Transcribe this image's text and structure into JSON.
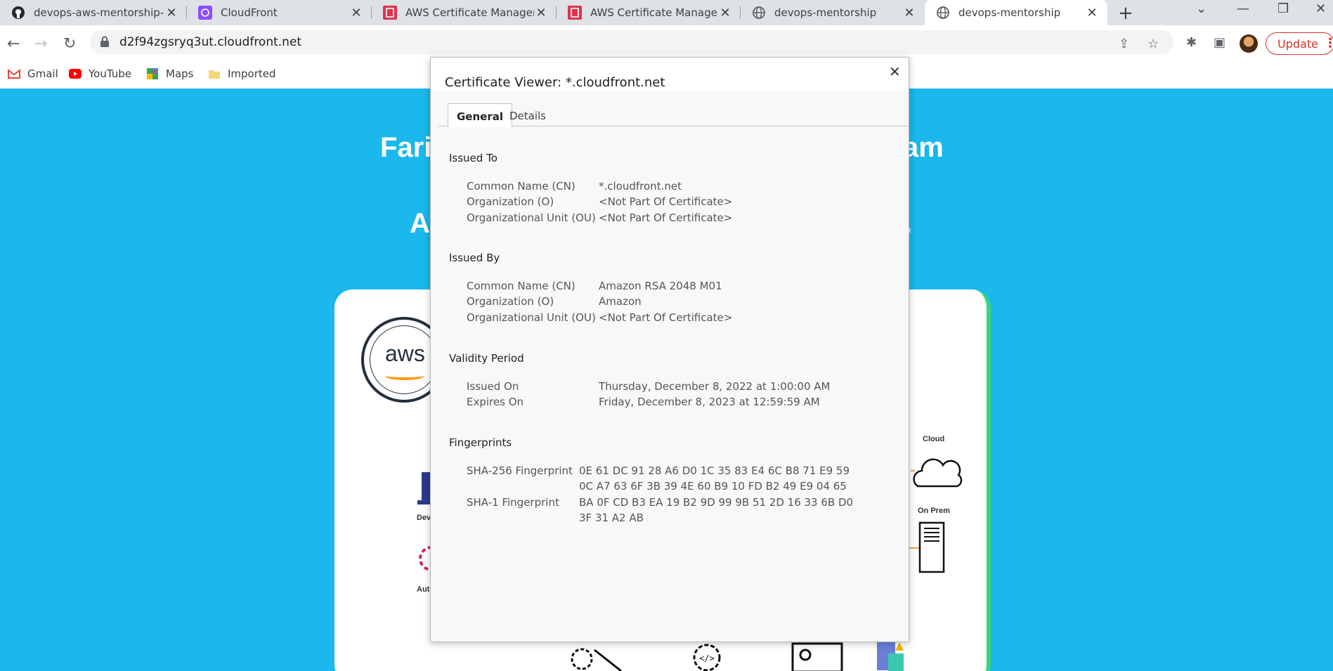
{
  "browser": {
    "tabs": [
      {
        "title": "devops-aws-mentorship-pr",
        "icon": "github-icon"
      },
      {
        "title": "CloudFront",
        "icon": "cloudfront-icon"
      },
      {
        "title": "AWS Certificate Manager",
        "icon": "acm-icon"
      },
      {
        "title": "AWS Certificate Manager",
        "icon": "acm-icon"
      },
      {
        "title": "devops-mentorship",
        "icon": "globe-icon"
      },
      {
        "title": "devops-mentorship",
        "icon": "globe-icon"
      }
    ],
    "url": "d2f94zgsryq3ut.cloudfront.net",
    "update_label": "Update",
    "bookmarks": [
      {
        "label": "Gmail",
        "icon": "gmail-icon"
      },
      {
        "label": "YouTube",
        "icon": "youtube-icon"
      },
      {
        "label": "Maps",
        "icon": "maps-icon"
      },
      {
        "label": "Imported",
        "icon": "folder-icon"
      }
    ]
  },
  "page": {
    "heading_line1_left": "Fari",
    "heading_line1_right": "am",
    "heading_line2_left": "A",
    "heading_line2_right": ".",
    "badge_text": "aws",
    "labels": {
      "cloud": "Cloud",
      "on_prem": "On Prem",
      "dev": "Dev",
      "auto": "Auto"
    }
  },
  "dialog": {
    "title": "Certificate Viewer: *.cloudfront.net",
    "tabs": [
      "General",
      "Details"
    ],
    "issued_to": {
      "heading": "Issued To",
      "rows": [
        {
          "label": "Common Name (CN)",
          "value": "*.cloudfront.net"
        },
        {
          "label": "Organization (O)",
          "value": "<Not Part Of Certificate>"
        },
        {
          "label": "Organizational Unit (OU)",
          "value": "<Not Part Of Certificate>"
        }
      ]
    },
    "issued_by": {
      "heading": "Issued By",
      "rows": [
        {
          "label": "Common Name (CN)",
          "value": "Amazon RSA 2048 M01"
        },
        {
          "label": "Organization (O)",
          "value": "Amazon"
        },
        {
          "label": "Organizational Unit (OU)",
          "value": "<Not Part Of Certificate>"
        }
      ]
    },
    "validity": {
      "heading": "Validity Period",
      "rows": [
        {
          "label": "Issued On",
          "value": "Thursday, December 8, 2022 at 1:00:00 AM"
        },
        {
          "label": "Expires On",
          "value": "Friday, December 8, 2023 at 12:59:59 AM"
        }
      ]
    },
    "fingerprints": {
      "heading": "Fingerprints",
      "sha256_label": "SHA-256 Fingerprint",
      "sha256_line1": "0E 61 DC 91 28 A6 D0 1C 35 83 E4 6C B8 71 E9 59",
      "sha256_line2": "0C A7 63 6F 3B 39 4E 60 B9 10 FD B2 49 E9 04 65",
      "sha1_label": "SHA-1 Fingerprint",
      "sha1_line1": "BA 0F CD B3 EA 19 B2 9D 99 9B 51 2D 16 33 6B D0",
      "sha1_line2": "3F 31 A2 AB"
    }
  }
}
